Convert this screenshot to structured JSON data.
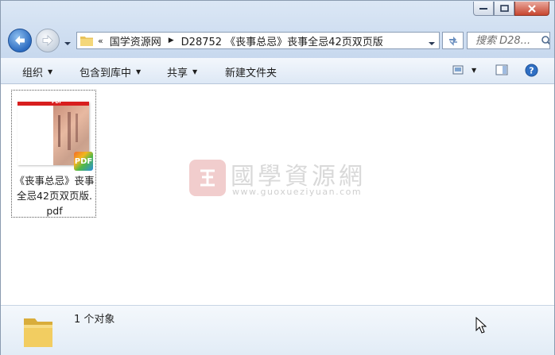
{
  "window": {
    "controls": {
      "minimize": "minimize",
      "maximize": "maximize",
      "close": "close"
    }
  },
  "address_bar": {
    "chevron": "«",
    "crumbs": [
      "国学资源网",
      "D28752 《丧事总忌》丧事全忌42页双页版"
    ]
  },
  "search": {
    "placeholder": "搜索 D28..."
  },
  "toolbar": {
    "organize": "组织",
    "include_in_library": "包含到库中",
    "share": "共享",
    "new_folder": "新建文件夹"
  },
  "files": [
    {
      "name_line1": "《丧事总忌》丧事",
      "name_line2": "全忌42页双页版.",
      "name_line3": "pdf",
      "badge": "PDF",
      "thumb_label": "PDF"
    }
  ],
  "watermark": {
    "text": "國學資源網",
    "url": "www.guoxueziyuan.com"
  },
  "status": {
    "count_text": "1 个对象"
  },
  "colors": {
    "titlebar": "#c7d8ee",
    "close_button": "#c7452f",
    "toolbar": "#dde8f5",
    "pdf_red": "#d81e1e"
  }
}
